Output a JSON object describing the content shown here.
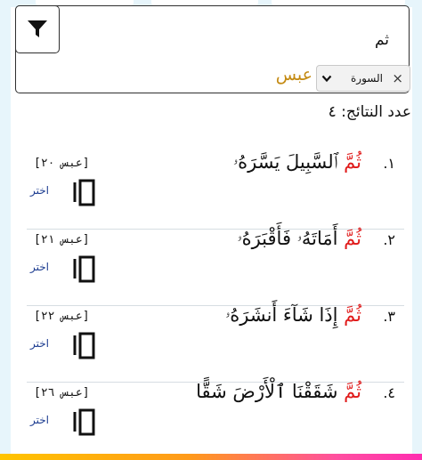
{
  "search": {
    "query": "ثم",
    "filter_chip_label": "السورة",
    "filter_chip_remove": "×",
    "surah_value": "عبس",
    "filter_icon": "funnel-icon",
    "chevron_icon": "chevron-down-icon"
  },
  "results_count_label": "عدد النتائج: ٤",
  "results": [
    {
      "number": "١.",
      "highlight": "ثُمَّ",
      "rest": " ٱلسَّبِيلَ يَسَّرَهُۥ",
      "reference": "[عبس ٢٠]",
      "action": "اختر",
      "icon": "copy-icon"
    },
    {
      "number": "٢.",
      "highlight": "ثُمَّ",
      "rest": " أَمَاتَهُۥ فَأَقْبَرَهُۥ",
      "reference": "[عبس ٢١]",
      "action": "اختر",
      "icon": "copy-icon"
    },
    {
      "number": "٣.",
      "highlight": "ثُمَّ",
      "rest": " إِذَا شَآءَ أَنشَرَهُۥ",
      "reference": "[عبس ٢٢]",
      "action": "اختر",
      "icon": "copy-icon"
    },
    {
      "number": "٤.",
      "highlight": "ثُمَّ",
      "rest": " شَقَقْنَا ٱلْأَرْضَ شَقًّا",
      "reference": "[عبس ٢٦]",
      "action": "اختر",
      "icon": "copy-icon"
    }
  ],
  "colors": {
    "highlight": "#e01a1a",
    "surah_value": "#c48a12",
    "action_link": "#1a3a8f",
    "background": "#e7f5fb"
  }
}
